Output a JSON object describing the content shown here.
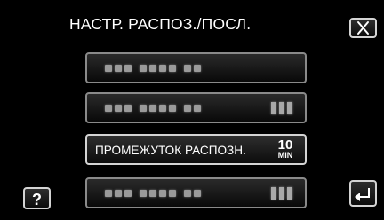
{
  "header": {
    "title": "НАСТР. РАСПОЗ./ПОСЛ."
  },
  "menu": {
    "items": [
      {
        "state": "disabled",
        "label_obscured": true,
        "has_value": false
      },
      {
        "state": "disabled",
        "label_obscured": true,
        "has_value": true
      },
      {
        "state": "enabled",
        "label": "ПРОМЕЖУТОК РАСПОЗН.",
        "value_number": "10",
        "value_unit": "MIN"
      },
      {
        "state": "disabled",
        "label_obscured": true,
        "has_value": true
      }
    ]
  },
  "buttons": {
    "help_label": "?"
  },
  "icons": {
    "close": "close-icon",
    "back": "back-arrow-icon"
  },
  "colors": {
    "background": "#000000",
    "text": "#ffffff",
    "button_border": "#d4d4d4",
    "disabled_border": "#8a8a8a"
  }
}
